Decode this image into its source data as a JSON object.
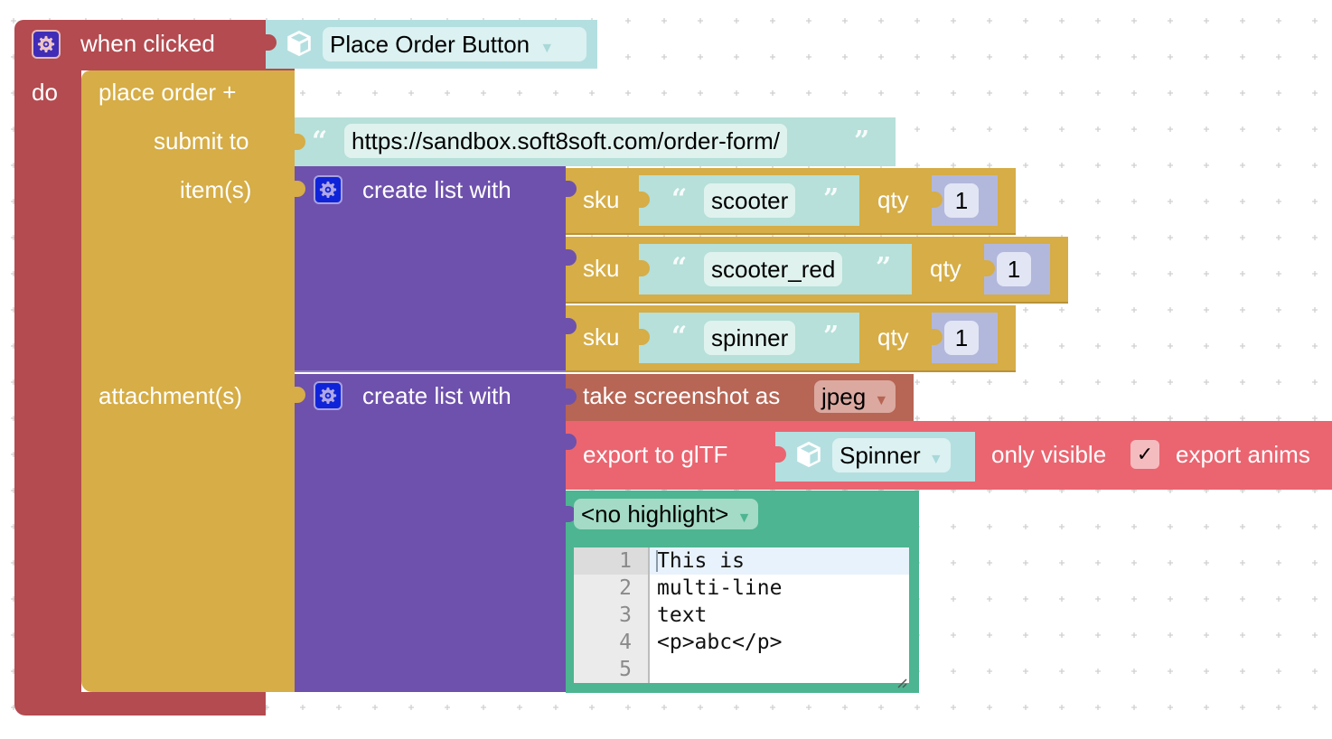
{
  "workspace": {
    "event_block": {
      "label": "when clicked",
      "do_label": "do",
      "object_field": "Place Order Button",
      "color": "#b34b50"
    },
    "place_order_block": {
      "title": "place order +",
      "submit_label": "submit to",
      "items_label": "item(s)",
      "attachments_label": "attachment(s)",
      "url": "https://sandbox.soft8soft.com/order-form/",
      "color": "#d6ad46"
    },
    "items_list": {
      "label": "create list with",
      "entries": [
        {
          "sku_label": "sku",
          "sku": "scooter",
          "qty_label": "qty",
          "qty": "1"
        },
        {
          "sku_label": "sku",
          "sku": "scooter_red",
          "qty_label": "qty",
          "qty": "1"
        },
        {
          "sku_label": "sku",
          "sku": "spinner",
          "qty_label": "qty",
          "qty": "1"
        }
      ]
    },
    "attachments_list": {
      "label": "create list with",
      "screenshot": {
        "label": "take screenshot as",
        "format": "jpeg"
      },
      "gltf": {
        "label": "export to glTF",
        "object": "Spinner",
        "only_visible_label": "only visible",
        "only_visible_checked": true,
        "check_mark": "✓",
        "export_anims_label": "export anims"
      },
      "code": {
        "highlight": "<no highlight>",
        "lines": [
          {
            "n": "1",
            "text": "This is"
          },
          {
            "n": "2",
            "text": "multi-line"
          },
          {
            "n": "3",
            "text": "text"
          },
          {
            "n": "4",
            "text": "<p>abc</p>"
          },
          {
            "n": "5",
            "text": ""
          }
        ]
      }
    },
    "quote_open": "“",
    "quote_close": "”",
    "dropdown_arrow": "▼"
  }
}
